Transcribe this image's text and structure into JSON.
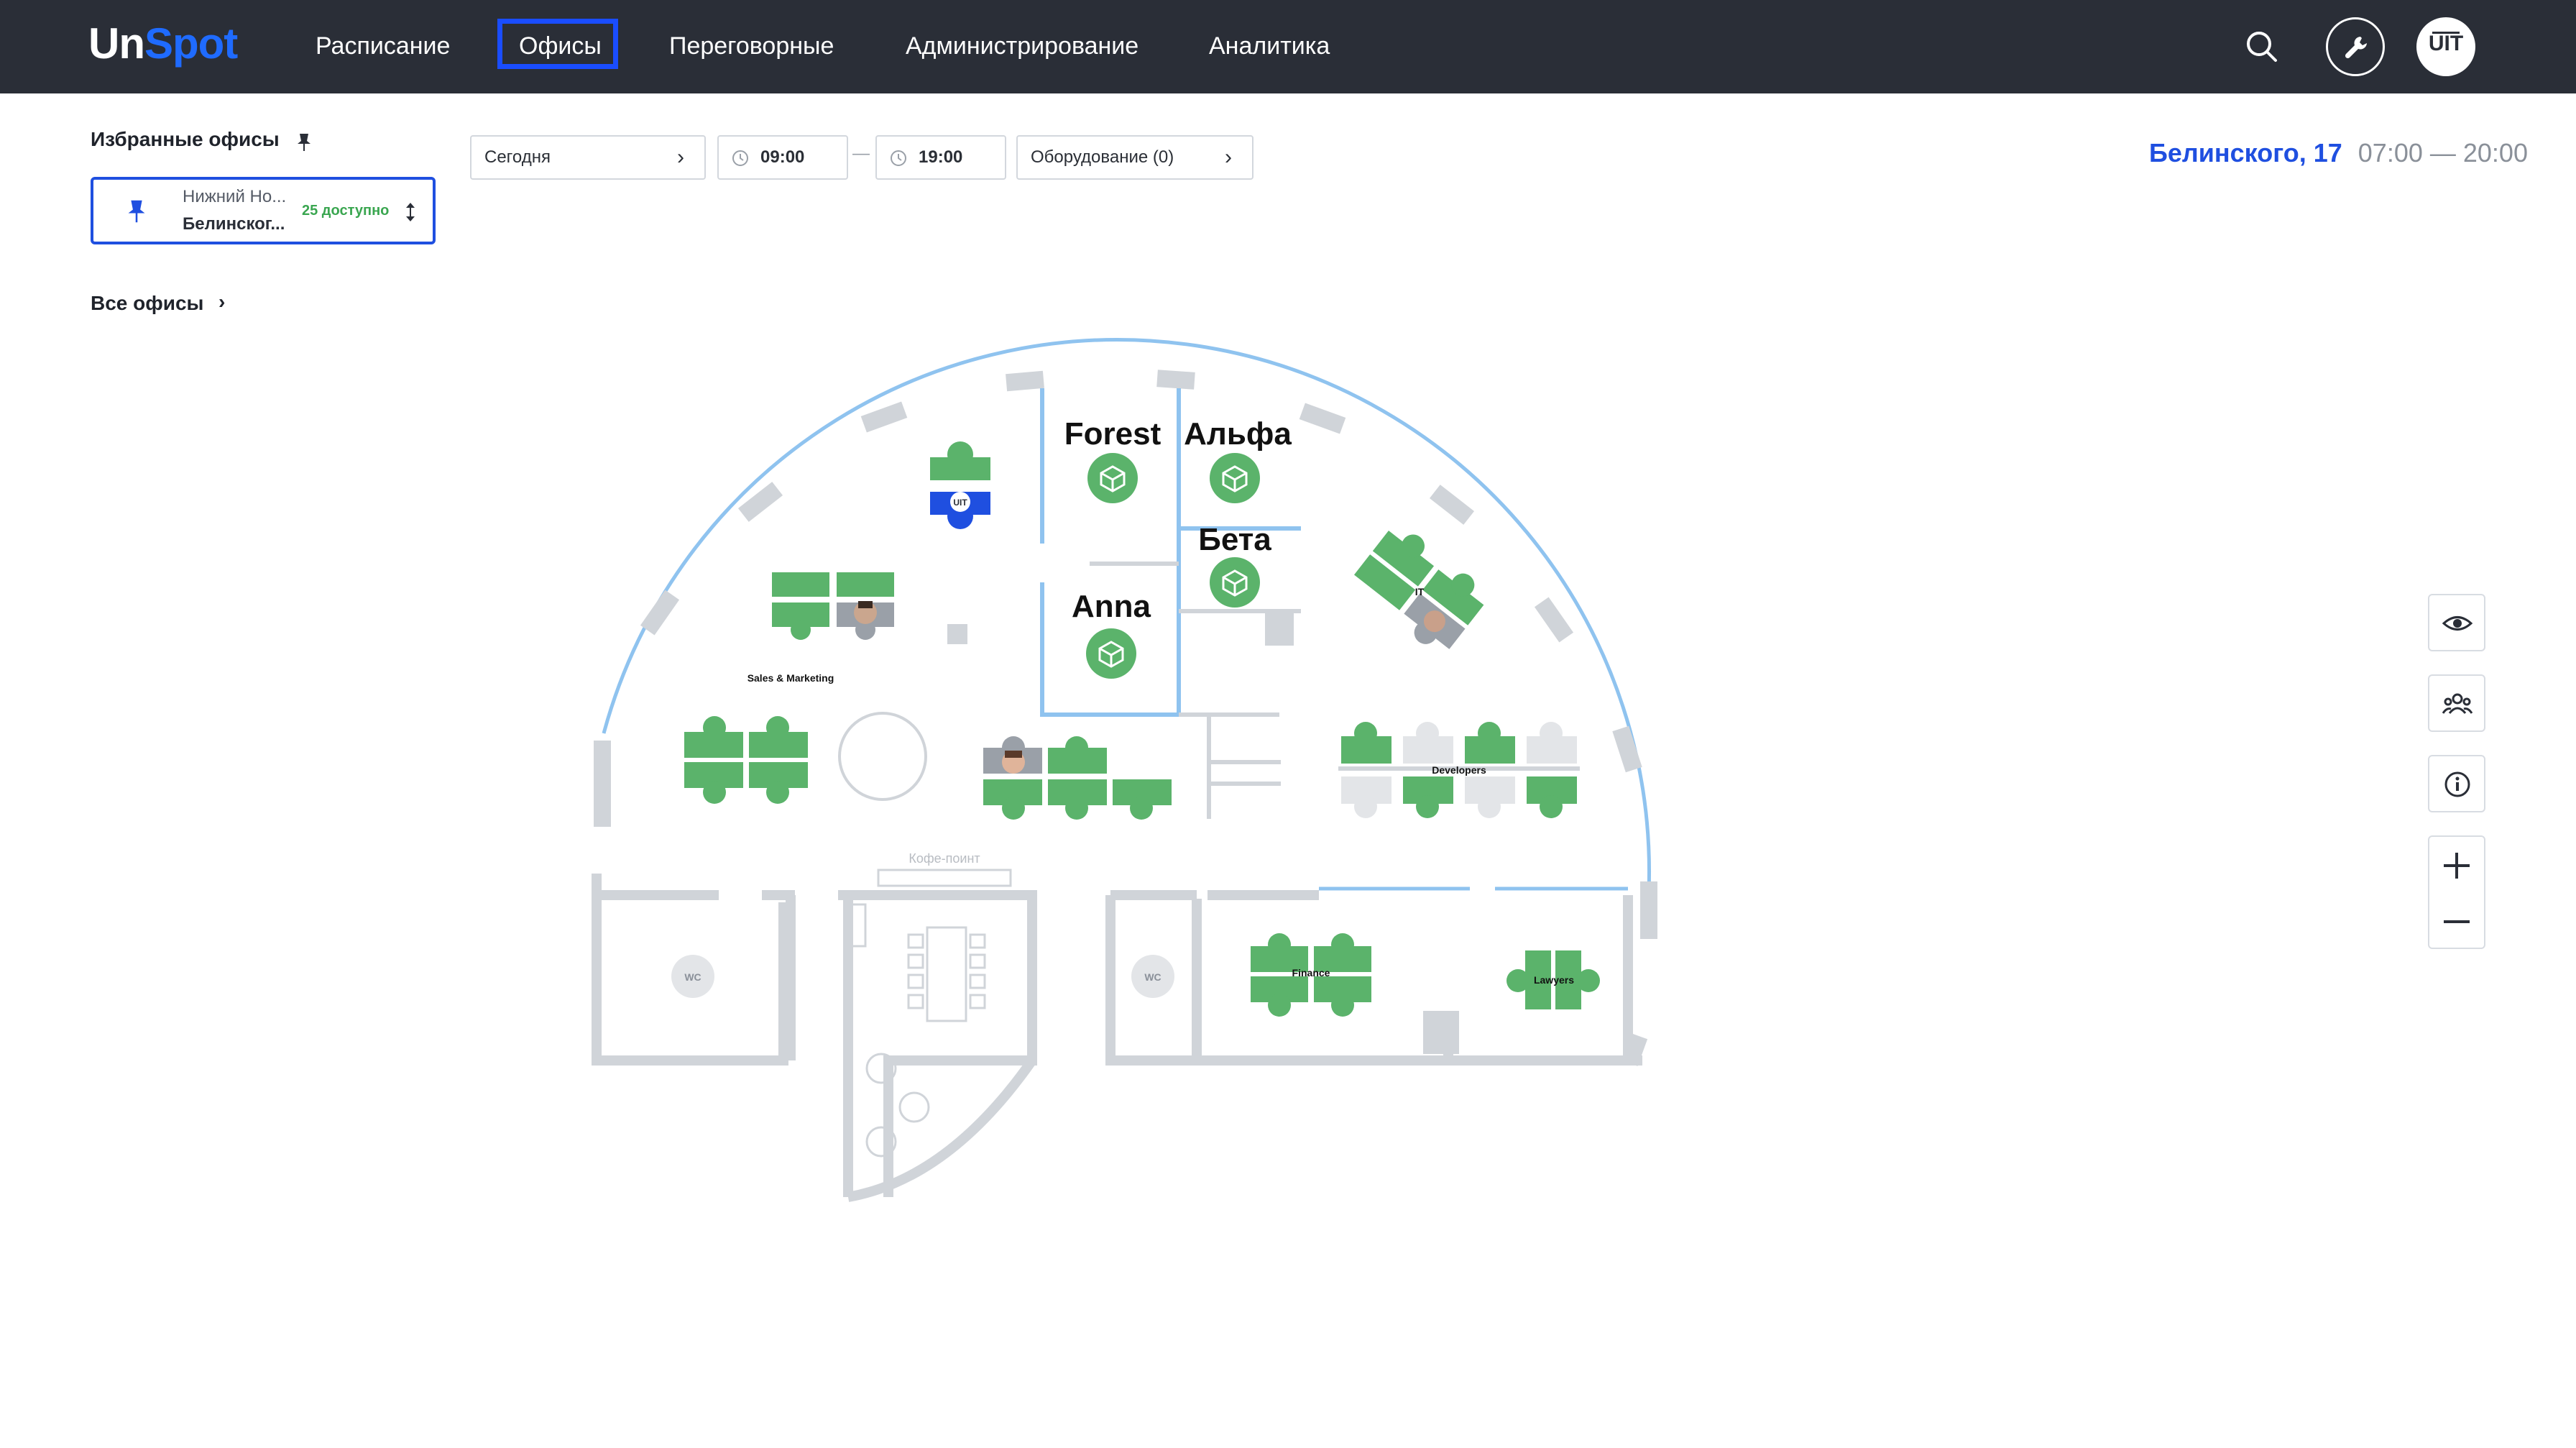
{
  "app": {
    "logo_part1": "Un",
    "logo_part2": "Spot",
    "avatar_text": "UIT"
  },
  "nav": {
    "items": [
      "Расписание",
      "Офисы",
      "Переговорные",
      "Администрирование",
      "Аналитика"
    ],
    "active": "Офисы"
  },
  "header_icons": [
    "search-icon",
    "wrench-icon"
  ],
  "colors": {
    "topbar": "#2a2e37",
    "accent_blue": "#1f4fe0",
    "desk_green": "#5bb36b",
    "available_green": "#3aa650",
    "wall_gray": "#d0d4d9",
    "window_blue": "#8fc3ef"
  },
  "sidebar": {
    "favorites_title": "Избранные офисы",
    "favorite": {
      "city": "Нижний Но...",
      "address": "Белинског...",
      "available": "25 доступно"
    },
    "all_offices_label": "Все офисы"
  },
  "filters": {
    "date": "Сегодня",
    "time_from": "09:00",
    "time_separator": "—",
    "time_to": "19:00",
    "equipment": "Оборудование (0)"
  },
  "office": {
    "address": "Белинского, 17",
    "hours": "07:00 — 20:00"
  },
  "map": {
    "rooms": [
      "Forest",
      "Альфа",
      "Бета",
      "Anna"
    ],
    "zones": [
      "Sales & Marketing",
      "IT",
      "Developers",
      "Finance",
      "Lawyers"
    ],
    "wc_label": "WC",
    "coffee_label": "Кофе-поинт",
    "desk_user_label": "UIT"
  },
  "tools": [
    "eye-icon",
    "people-icon",
    "info-icon",
    "zoom-in-icon",
    "zoom-out-icon"
  ]
}
